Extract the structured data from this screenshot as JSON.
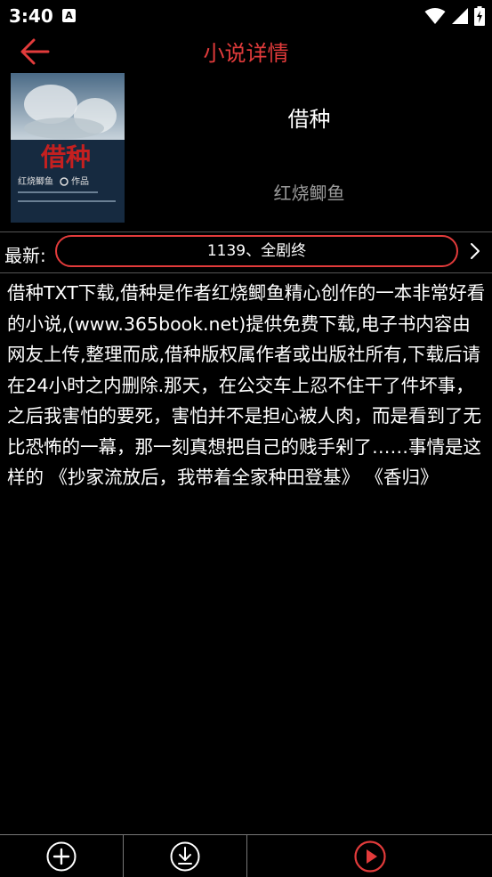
{
  "status_bar": {
    "time": "3:40",
    "notification_icon": "a-badge-icon",
    "icons": [
      "wifi-icon",
      "signal-icon",
      "battery-charging-icon"
    ]
  },
  "app_bar": {
    "title": "小说详情",
    "back_icon": "arrow-left-icon",
    "accent_color": "#e23b3b"
  },
  "book": {
    "title": "借种",
    "author": "红烧鲫鱼",
    "cover": {
      "title_text": "借种",
      "author_text": "红烧鲫鱼",
      "tag_text": "作品"
    }
  },
  "latest": {
    "label": "最新:",
    "chapter": "1139、全剧终",
    "arrow_icon": "chevron-right-icon"
  },
  "description": "借种TXT下载,借种是作者红烧鲫鱼精心创作的一本非常好看的小说,(www.365book.net)提供免费下载,电子书内容由网友上传,整理而成,借种版权属作者或出版社所有,下载后请在24小时之内删除.那天，在公交车上忍不住干了件坏事，之后我害怕的要死，害怕并不是担心被人肉，而是看到了无比恐怖的一幕，那一刻真想把自己的贱手剁了……事情是这样的 《抄家流放后，我带着全家种田登基》 《香归》",
  "bottom_bar": {
    "buttons": [
      {
        "icon": "add-circle-icon"
      },
      {
        "icon": "download-circle-icon"
      },
      {
        "icon": "play-circle-icon"
      }
    ]
  }
}
